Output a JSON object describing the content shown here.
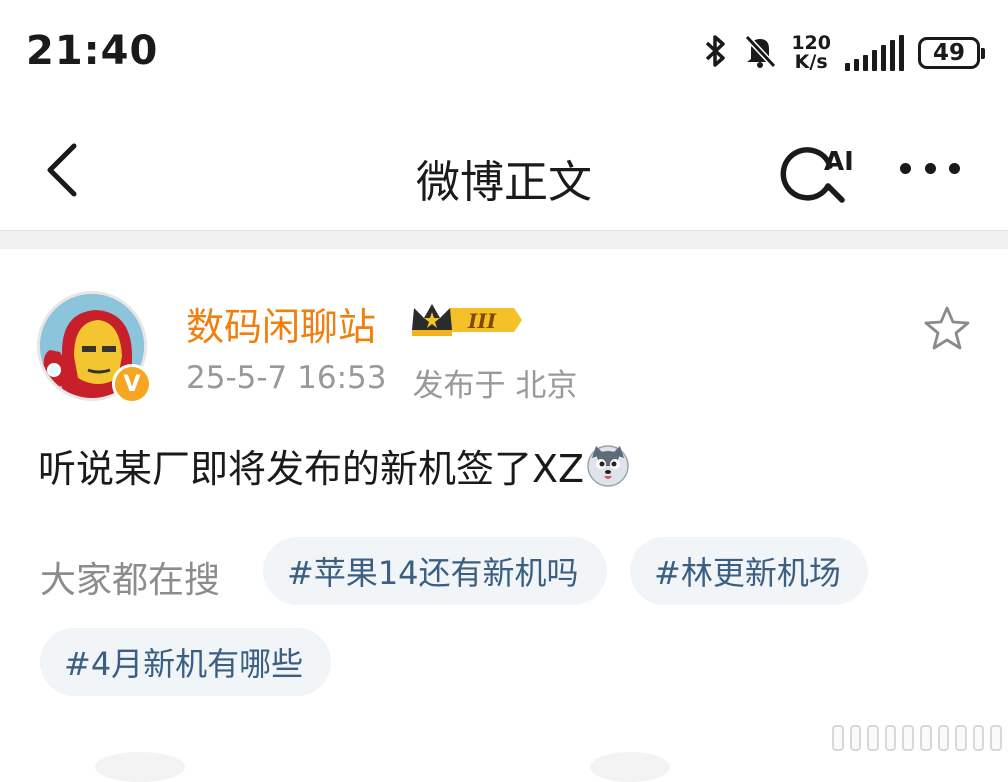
{
  "status_bar": {
    "time": "21:40",
    "network_speed_value": "120",
    "network_speed_unit": "K/s",
    "battery": "49",
    "icons": [
      "bluetooth-icon",
      "mute-icon",
      "signal-icon",
      "battery-icon"
    ]
  },
  "nav": {
    "title": "微博正文",
    "ai_label": "AI",
    "icons": [
      "back-arrow-icon",
      "ai-search-icon",
      "more-dots-icon"
    ]
  },
  "post": {
    "username": "数码闲聊站",
    "member_level": "III",
    "verified_mark": "V",
    "date": "25-5-7 16:53",
    "location": "发布于 北京",
    "text": "听说某厂即将发布的新机签了XZ",
    "emoji": "husky-emoji-icon"
  },
  "trending": {
    "label": "大家都在搜",
    "tags": [
      "#苹果14还有新机吗",
      "#林更新机场",
      "#4月新机有哪些"
    ]
  },
  "colors": {
    "username": "#f17f0d",
    "tag_text": "#3b5f82",
    "tag_bg": "#f2f5f8",
    "meta_text": "#999999"
  }
}
